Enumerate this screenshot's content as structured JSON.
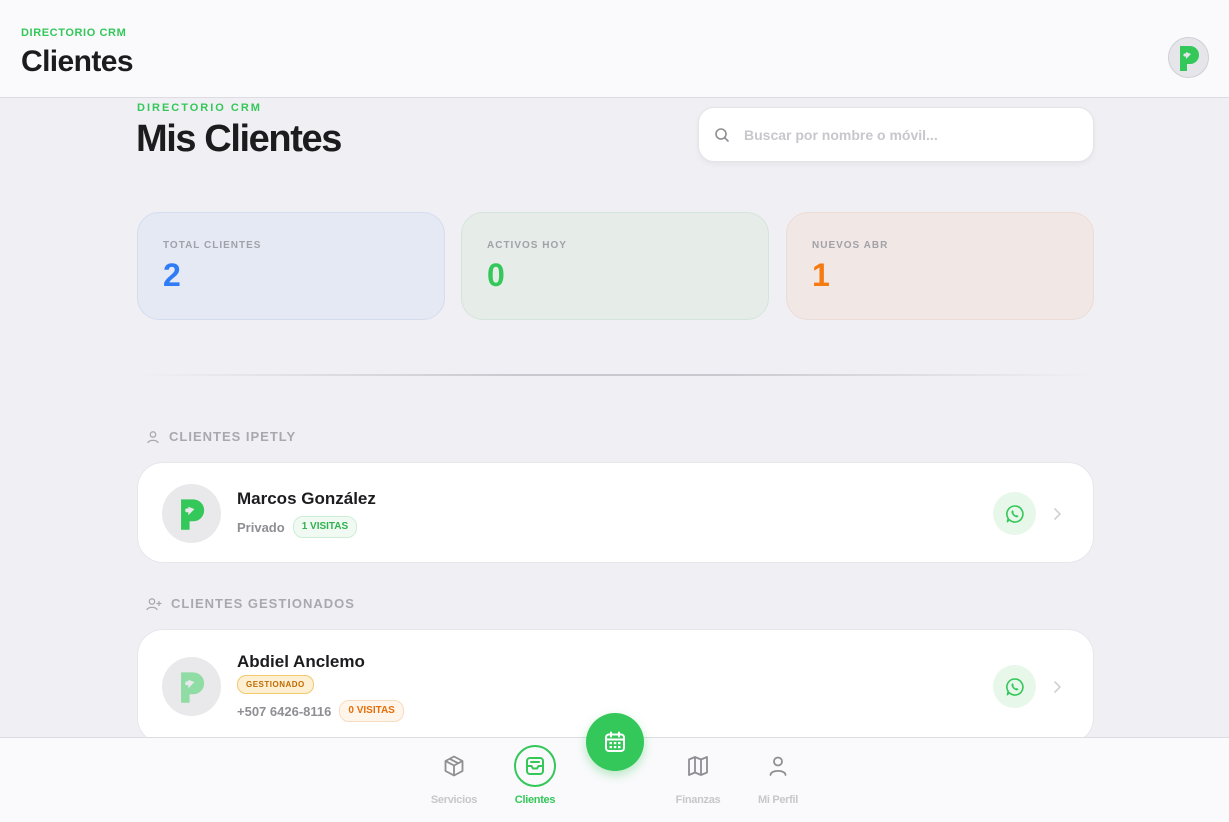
{
  "header": {
    "eyebrow": "DIRECTORIO CRM",
    "title": "Clientes",
    "avatar_icon": "brand-logo-icon"
  },
  "main": {
    "eyebrow": "DIRECTORIO CRM",
    "title": "Mis Clientes",
    "search": {
      "placeholder": "Buscar por nombre o móvil...",
      "value": ""
    }
  },
  "stats": [
    {
      "label": "TOTAL CLIENTES",
      "value": "2",
      "color": "#2f7cf6"
    },
    {
      "label": "ACTIVOS HOY",
      "value": "0",
      "color": "#34c759"
    },
    {
      "label": "NUEVOS ABR",
      "value": "1",
      "color": "#f57a10"
    }
  ],
  "sections": {
    "ipetly": {
      "title": "CLIENTES IPETLY",
      "clients": [
        {
          "name": "Marcos González",
          "subtitle": "Privado",
          "visits": "1 VISITAS"
        }
      ]
    },
    "gestionados": {
      "title": "CLIENTES GESTIONADOS",
      "clients": [
        {
          "name": "Abdiel Anclemo",
          "tag": "GESTIONADO",
          "phone": "+507 6426-8116",
          "visits": "0 VISITAS"
        }
      ]
    }
  },
  "bottom_nav": {
    "items": [
      {
        "label": "Servicios",
        "icon": "box-icon"
      },
      {
        "label": "Clientes",
        "icon": "inbox-icon",
        "active": true
      },
      {
        "label": "Finanzas",
        "icon": "map-icon"
      },
      {
        "label": "Mi Perfil",
        "icon": "user-icon"
      }
    ],
    "fab_icon": "calendar-icon"
  },
  "colors": {
    "accent": "#34c759",
    "blue": "#2f7cf6",
    "orange": "#f57a10"
  }
}
